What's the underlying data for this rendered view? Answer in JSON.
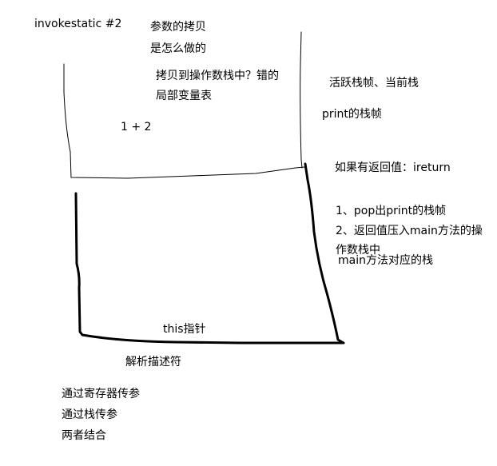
{
  "colors": {
    "background": "#ffffff",
    "ink": "#000000"
  },
  "notes": {
    "invokestatic": "invokestatic #2",
    "param_copy_line1": "参数的拷贝",
    "param_copy_line2": "是怎么做的",
    "copy_to_stack_line1": "拷贝到操作数栈中？错的",
    "copy_to_stack_line2": "局部变量表",
    "expression": "1 + 2",
    "active_frame": "活跃栈帧、当前栈",
    "print_frame": "print的栈帧",
    "return_value": "如果有返回值：ireturn",
    "step1": "1、pop出print的栈帧",
    "step2_line1": "2、返回值压入main方法的操",
    "step2_line2": "作数栈中",
    "main_stack": "main方法对应的栈",
    "this_pointer": "this指针",
    "descriptor": "解析描述符",
    "pass_register": "通过寄存器传参",
    "pass_stack": "通过栈传参",
    "combined": "两者结合"
  }
}
